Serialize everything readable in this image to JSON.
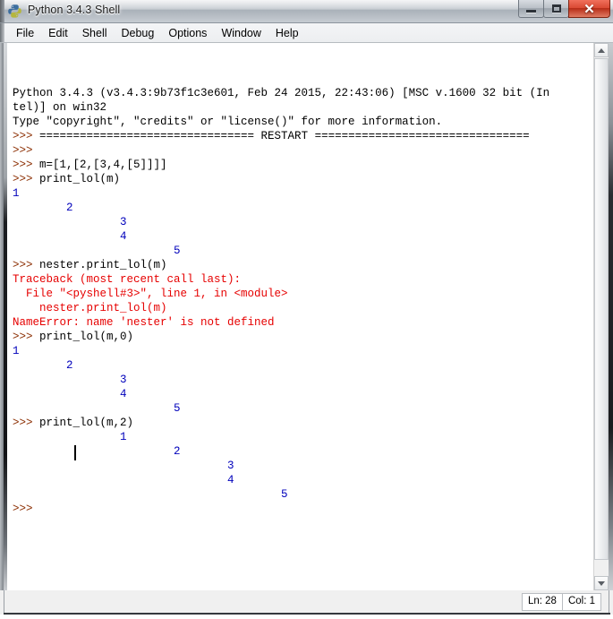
{
  "window": {
    "title": "Python 3.4.3 Shell",
    "icon": "python-logo-icon",
    "controls": {
      "minimize": "–",
      "maximize": "□",
      "close": "✕"
    }
  },
  "menubar": {
    "items": [
      {
        "label": "File"
      },
      {
        "label": "Edit"
      },
      {
        "label": "Shell"
      },
      {
        "label": "Debug"
      },
      {
        "label": "Options"
      },
      {
        "label": "Window"
      },
      {
        "label": "Help"
      }
    ]
  },
  "console": {
    "lines": [
      {
        "kind": "code",
        "text": "Python 3.4.3 (v3.4.3:9b73f1c3e601, Feb 24 2015, 22:43:06) [MSC v.1600 32 bit (In"
      },
      {
        "kind": "code",
        "text": "tel)] on win32"
      },
      {
        "kind": "code",
        "text": "Type \"copyright\", \"credits\" or \"license()\" for more information."
      },
      {
        "kind": "restart",
        "prompt": ">>> ",
        "text": "================================ RESTART ================================"
      },
      {
        "kind": "prompt",
        "prompt": ">>> ",
        "text": ""
      },
      {
        "kind": "prompt",
        "prompt": ">>> ",
        "text": "m=[1,[2,[3,4,[5]]]]"
      },
      {
        "kind": "prompt",
        "prompt": ">>> ",
        "text": "print_lol(m)"
      },
      {
        "kind": "stdout",
        "text": "1"
      },
      {
        "kind": "stdout",
        "text": "        2"
      },
      {
        "kind": "stdout",
        "text": "                3"
      },
      {
        "kind": "stdout",
        "text": "                4"
      },
      {
        "kind": "stdout",
        "text": "                        5"
      },
      {
        "kind": "prompt",
        "prompt": ">>> ",
        "text": "nester.print_lol(m)"
      },
      {
        "kind": "err",
        "text": "Traceback (most recent call last):"
      },
      {
        "kind": "err",
        "text": "  File \"<pyshell#3>\", line 1, in <module>"
      },
      {
        "kind": "err",
        "text": "    nester.print_lol(m)"
      },
      {
        "kind": "err",
        "text": "NameError: name 'nester' is not defined"
      },
      {
        "kind": "prompt",
        "prompt": ">>> ",
        "text": "print_lol(m,0)"
      },
      {
        "kind": "stdout",
        "text": "1"
      },
      {
        "kind": "stdout",
        "text": "        2"
      },
      {
        "kind": "stdout",
        "text": "                3"
      },
      {
        "kind": "stdout",
        "text": "                4"
      },
      {
        "kind": "stdout",
        "text": "                        5"
      },
      {
        "kind": "prompt",
        "prompt": ">>> ",
        "text": "print_lol(m,2)"
      },
      {
        "kind": "stdout",
        "text": "                1"
      },
      {
        "kind": "stdout",
        "text": "                        2"
      },
      {
        "kind": "stdout",
        "text": "                                3"
      },
      {
        "kind": "stdout",
        "text": "                                4"
      },
      {
        "kind": "stdout",
        "text": "                                        5"
      },
      {
        "kind": "prompt",
        "prompt": ">>> ",
        "text": ""
      }
    ],
    "colors": {
      "prompt": "#8b2d00",
      "stdout": "#0000bb",
      "error": "#e60000",
      "code": "#000000",
      "background": "#ffffff"
    }
  },
  "statusbar": {
    "line_label": "Ln: 28",
    "col_label": "Col: 1"
  },
  "scrollbar": {
    "up_arrow": "scroll-up-arrow-icon",
    "down_arrow": "scroll-down-arrow-icon"
  }
}
